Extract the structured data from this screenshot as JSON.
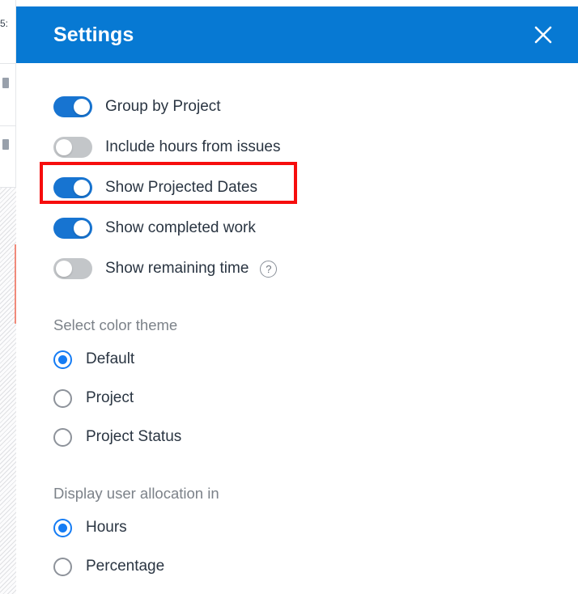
{
  "backdrop": {
    "left_label": "5:",
    "colors": {
      "hatch": "#e8eaed",
      "red_line": "#f08a7a"
    }
  },
  "modal": {
    "header": {
      "title": "Settings",
      "close_icon": "close-icon",
      "background_color": "#0779d3",
      "title_color": "#ffffff"
    },
    "toggles": [
      {
        "label": "Group by Project",
        "state": "on",
        "help": false
      },
      {
        "label": "Include hours from issues",
        "state": "off",
        "help": false
      },
      {
        "label": "Show Projected Dates",
        "state": "on",
        "help": false,
        "highlighted": true
      },
      {
        "label": "Show completed work",
        "state": "on",
        "help": false
      },
      {
        "label": "Show remaining time",
        "state": "off",
        "help": true,
        "help_icon": "help-circle-icon",
        "help_glyph": "?"
      }
    ],
    "sections": [
      {
        "title": "Select color theme",
        "options": [
          {
            "label": "Default",
            "selected": true
          },
          {
            "label": "Project",
            "selected": false
          },
          {
            "label": "Project Status",
            "selected": false
          }
        ]
      },
      {
        "title": "Display user allocation in",
        "options": [
          {
            "label": "Hours",
            "selected": true
          },
          {
            "label": "Percentage",
            "selected": false
          }
        ]
      }
    ],
    "annotation": {
      "color": "#f60d0d",
      "target": "Show Projected Dates"
    }
  }
}
